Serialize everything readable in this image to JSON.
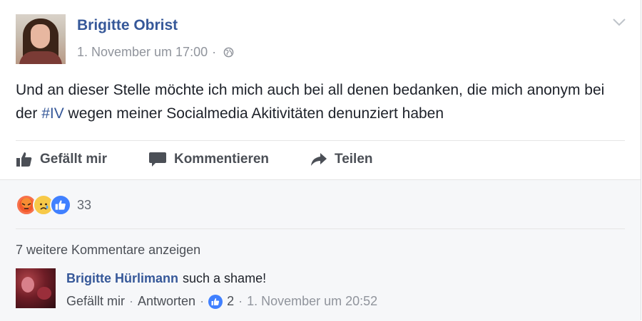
{
  "post": {
    "author": "Brigitte Obrist",
    "timestamp": "1. November um 17:00",
    "separator": "·",
    "text_before_tag": "Und an dieser Stelle möchte ich mich auch bei all denen bedanken, die mich anonym bei der ",
    "hashtag": "#IV",
    "text_after_tag": " wegen meiner Socialmedia Akitivitäten denunziert haben",
    "privacy_icon": "globe-icon",
    "options_icon": "chevron-down-icon"
  },
  "actions": {
    "like": "Gefällt mir",
    "comment": "Kommentieren",
    "share": "Teilen"
  },
  "reactions": {
    "types": [
      "angry",
      "sad",
      "like"
    ],
    "count": "33"
  },
  "comments": {
    "more_label": "7 weitere Kommentare anzeigen",
    "items": [
      {
        "author": "Brigitte Hürlimann",
        "text": "such a shame!",
        "like_label": "Gefällt mir",
        "reply_label": "Antworten",
        "likes": "2",
        "timestamp": "1. November um 20:52"
      }
    ]
  },
  "colors": {
    "link_blue": "#365899",
    "meta_gray": "#90949c",
    "like_blue": "#4080ff"
  }
}
